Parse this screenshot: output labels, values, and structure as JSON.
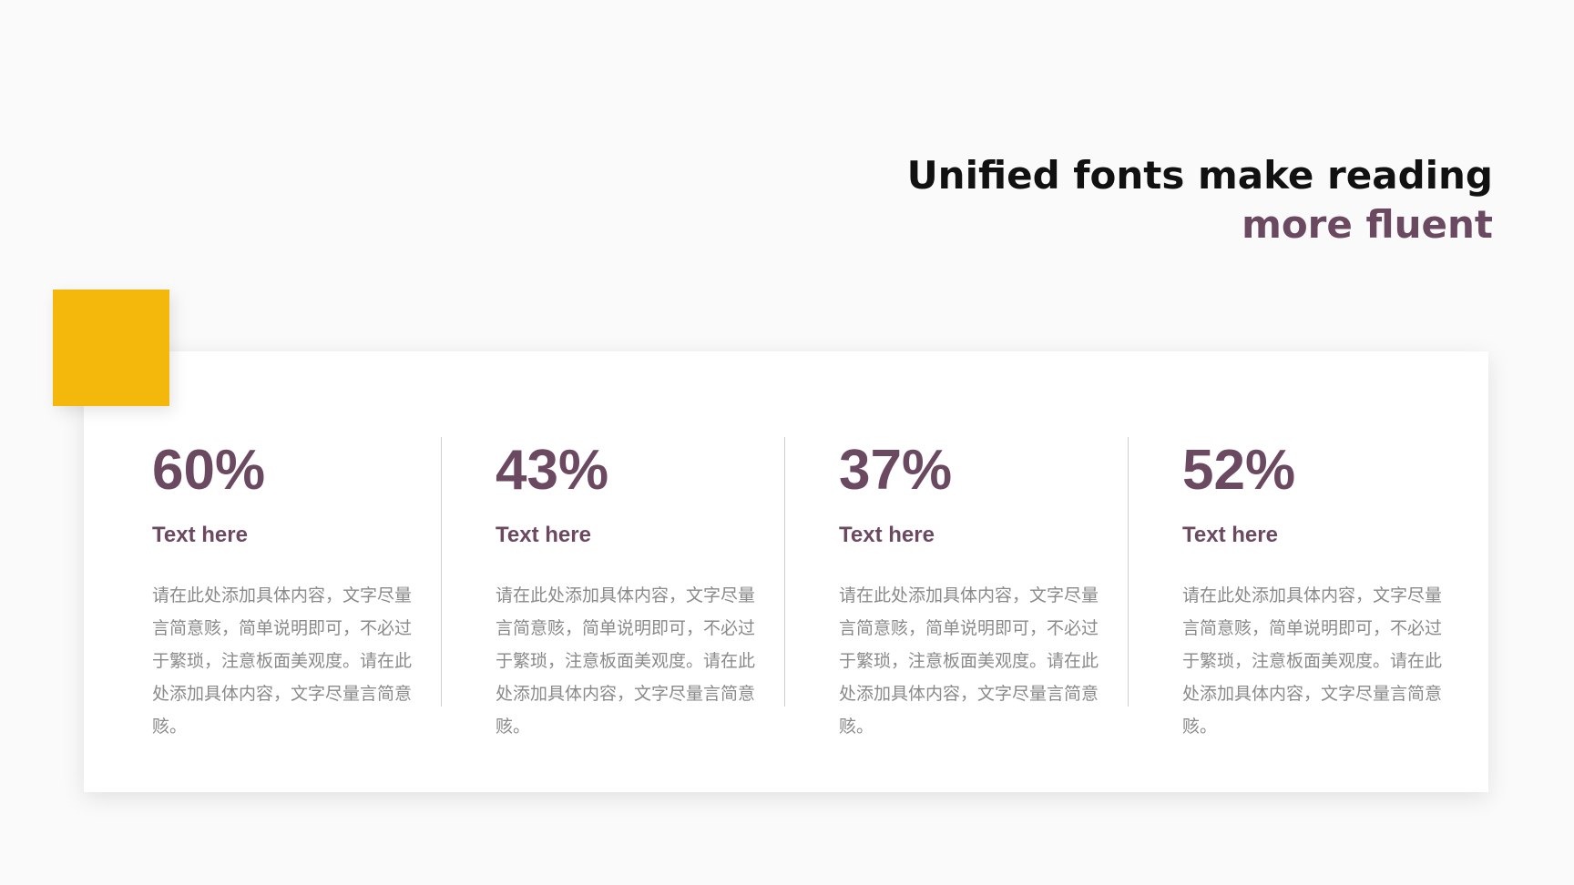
{
  "title": {
    "line1": "Unified fonts make reading",
    "line2": "more fluent"
  },
  "colors": {
    "accent": "#f4b70c",
    "primary": "#6b4a61",
    "heading": "#111111",
    "body_text": "#8a8a8a"
  },
  "stats": [
    {
      "value": "60%",
      "label": "Text here",
      "desc": "请在此处添加具体内容，文字尽量言简意赅，简单说明即可，不必过于繁琐，注意板面美观度。请在此处添加具体内容，文字尽量言简意赅。"
    },
    {
      "value": "43%",
      "label": "Text here",
      "desc": "请在此处添加具体内容，文字尽量言简意赅，简单说明即可，不必过于繁琐，注意板面美观度。请在此处添加具体内容，文字尽量言简意赅。"
    },
    {
      "value": "37%",
      "label": "Text here",
      "desc": "请在此处添加具体内容，文字尽量言简意赅，简单说明即可，不必过于繁琐，注意板面美观度。请在此处添加具体内容，文字尽量言简意赅。"
    },
    {
      "value": "52%",
      "label": "Text here",
      "desc": "请在此处添加具体内容，文字尽量言简意赅，简单说明即可，不必过于繁琐，注意板面美观度。请在此处添加具体内容，文字尽量言简意赅。"
    }
  ]
}
